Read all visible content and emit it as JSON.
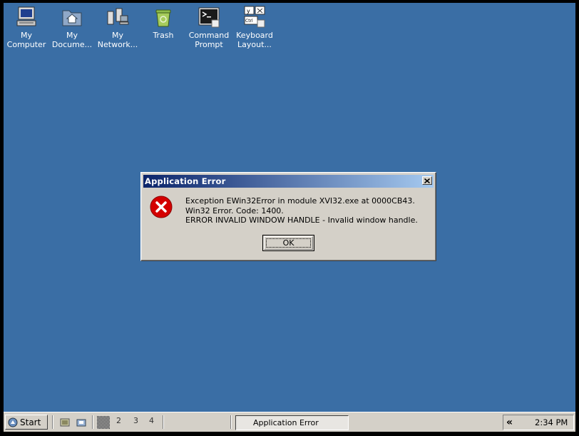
{
  "desktop": {
    "background": "#3a6ea5",
    "icons": [
      {
        "label": "My\nComputer",
        "icon": "computer-icon"
      },
      {
        "label": "My\nDocume...",
        "icon": "documents-folder-icon"
      },
      {
        "label": "My\nNetwork...",
        "icon": "network-icon"
      },
      {
        "label": "Trash",
        "icon": "trash-icon"
      },
      {
        "label": "Command\nPrompt",
        "icon": "command-prompt-icon"
      },
      {
        "label": "Keyboard\nLayout...",
        "icon": "keyboard-layout-icon"
      }
    ]
  },
  "dialog": {
    "title": "Application Error",
    "icon": "error-icon",
    "lines": [
      "Exception EWin32Error in module XVI32.exe at 0000CB43.",
      "Win32 Error.  Code: 1400.",
      "ERROR INVALID WINDOW HANDLE - Invalid window handle."
    ],
    "ok_label": "OK"
  },
  "taskbar": {
    "start_label": "Start",
    "pager": [
      "2",
      "3",
      "4"
    ],
    "task_label": "Application Error",
    "tray_chevron": "«",
    "clock": "2:34 PM"
  }
}
